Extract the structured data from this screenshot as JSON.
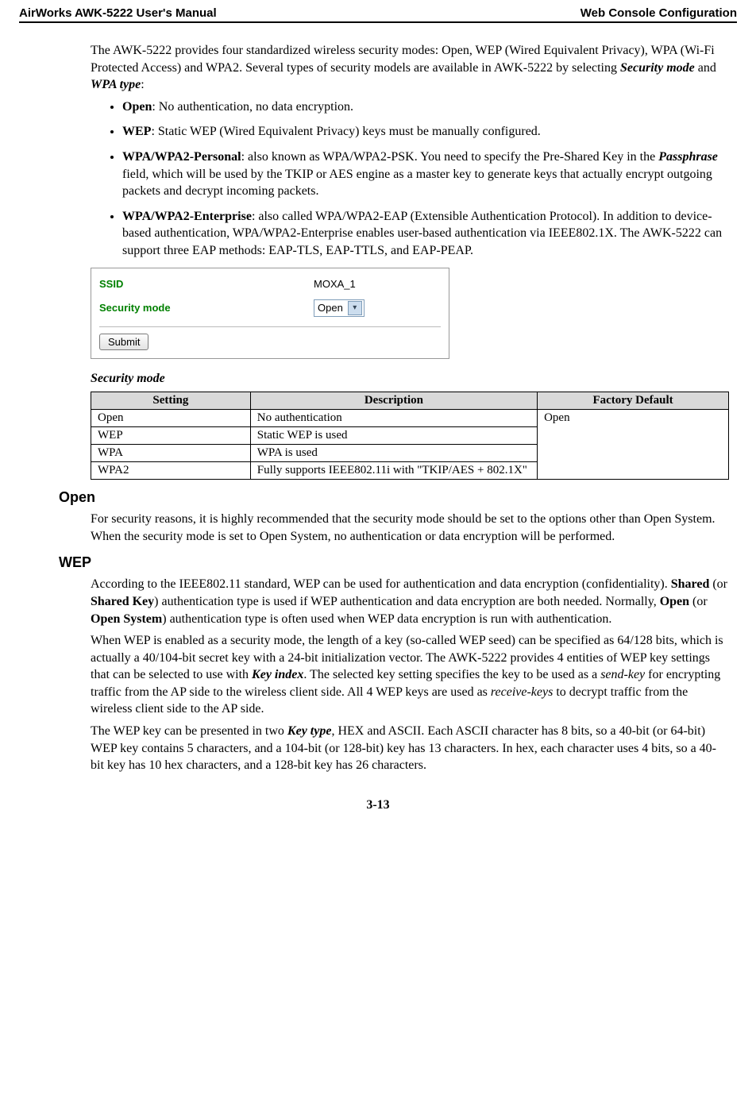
{
  "header": {
    "left": "AirWorks AWK-5222 User's Manual",
    "right": "Web Console Configuration"
  },
  "intro": {
    "p1_a": "The AWK-5222 provides four standardized wireless security modes: Open, WEP (Wired Equivalent Privacy), WPA (Wi-Fi Protected Access) and WPA2. Several types of security models are available in AWK-5222 by selecting ",
    "p1_b": "Security mode",
    "p1_c": " and ",
    "p1_d": "WPA type",
    "p1_e": ":",
    "bullets": [
      {
        "lead_bold": "Open",
        "rest": ": No authentication, no data encryption."
      },
      {
        "lead_bold": "WEP",
        "rest": ": Static WEP (Wired Equivalent Privacy) keys must be manually configured."
      },
      {
        "lead_bold": "WPA/WPA2-Personal",
        "rest_a": ": also known as WPA/WPA2-PSK. You need to specify the Pre-Shared Key in the ",
        "rest_b_italic": "Passphrase",
        "rest_c": " field, which will be used by the TKIP or AES engine as a master key to generate keys that actually encrypt outgoing packets and decrypt incoming packets."
      },
      {
        "lead_bold": "WPA/WPA2-Enterprise",
        "rest": ": also called WPA/WPA2-EAP (Extensible Authentication Protocol). In addition to device-based authentication, WPA/WPA2-Enterprise enables user-based authentication via IEEE802.1X. The AWK-5222 can support three EAP methods: EAP-TLS, EAP-TTLS, and EAP-PEAP."
      }
    ]
  },
  "screenshot": {
    "ssid_label": "SSID",
    "ssid_value": "MOXA_1",
    "secmode_label": "Security mode",
    "secmode_value": "Open",
    "submit_label": "Submit"
  },
  "table_title": "Security mode",
  "table_headers": {
    "setting": "Setting",
    "description": "Description",
    "default": "Factory Default"
  },
  "table_rows": [
    {
      "setting": "Open",
      "description": "No authentication"
    },
    {
      "setting": "WEP",
      "description": "Static WEP is used"
    },
    {
      "setting": "WPA",
      "description": "WPA is used"
    },
    {
      "setting": "WPA2",
      "description": "Fully supports IEEE802.11i with \"TKIP/AES + 802.1X\""
    }
  ],
  "table_default": "Open",
  "open_section": {
    "heading": "Open",
    "p1": "For security reasons, it is highly recommended that the security mode should be set to the options other than Open System. When the security mode is set to Open System, no authentication or data encryption will be performed."
  },
  "wep_section": {
    "heading": "WEP",
    "p1_a": "According to the IEEE802.11 standard, WEP can be used for authentication and data encryption (confidentiality). ",
    "p1_b_bold": "Shared",
    "p1_c": " (or ",
    "p1_d_bold": "Shared Key",
    "p1_e": ") authentication type is used if WEP authentication and data encryption are both needed. Normally, ",
    "p1_f_bold": "Open",
    "p1_g": " (or ",
    "p1_h_bold": "Open System",
    "p1_i": ") authentication type is often used when WEP data encryption is run with authentication.",
    "p2_a": "When WEP is enabled as a security mode, the length of a key (so-called WEP seed) can be specified as 64/128 bits, which is actually a 40/104-bit secret key with a 24-bit initialization vector. The AWK-5222 provides 4 entities of WEP key settings that can be selected to use with ",
    "p2_b_italic": "Key index",
    "p2_c": ". The selected key setting specifies the key to be used as a ",
    "p2_d_italic_plain": "send-key",
    "p2_e": " for encrypting traffic from the AP side to the wireless client side. All 4 WEP keys are used as ",
    "p2_f_italic_plain": "receive-keys",
    "p2_g": " to decrypt traffic from the wireless client side to the AP side.",
    "p3_a": "The WEP key can be presented in two ",
    "p3_b_italic": "Key type",
    "p3_c": ", HEX and ASCII. Each ASCII character has 8 bits, so a 40-bit (or 64-bit) WEP key contains 5 characters, and a 104-bit (or 128-bit) key has 13 characters. In hex, each character uses 4 bits, so a 40-bit key has 10 hex characters, and a 128-bit key has 26 characters."
  },
  "footer": "3-13"
}
